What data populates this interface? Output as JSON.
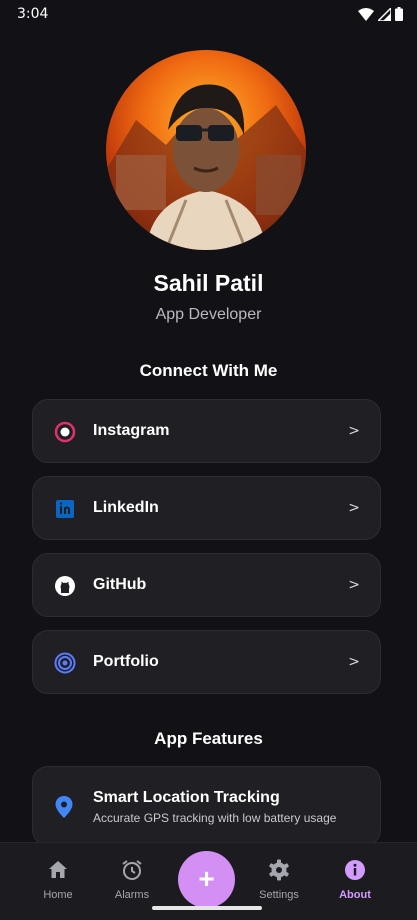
{
  "status_bar": {
    "time": "3:04"
  },
  "profile": {
    "name": "Sahil Patil",
    "role": "App Developer"
  },
  "connect": {
    "title": "Connect With Me",
    "items": [
      {
        "label": "Instagram",
        "icon": "instagram-icon",
        "arrow": ">"
      },
      {
        "label": "LinkedIn",
        "icon": "linkedin-icon",
        "arrow": ">"
      },
      {
        "label": "GitHub",
        "icon": "github-icon",
        "arrow": ">"
      },
      {
        "label": "Portfolio",
        "icon": "target-icon",
        "arrow": ">"
      }
    ]
  },
  "features": {
    "title": "App Features",
    "items": [
      {
        "title": "Smart Location Tracking",
        "description": "Accurate GPS tracking with low battery usage",
        "icon": "location-pin-icon"
      }
    ]
  },
  "bottom_nav": {
    "items": [
      {
        "label": "Home",
        "icon": "home-icon"
      },
      {
        "label": "Alarms",
        "icon": "alarm-clock-icon"
      },
      {
        "label": "Settings",
        "icon": "gear-icon"
      },
      {
        "label": "About",
        "icon": "info-icon",
        "active": true
      }
    ],
    "fab_label": "+"
  },
  "colors": {
    "background": "#121216",
    "card": "#1f1f24",
    "accent": "#d48ff5",
    "instagram": "#e1306c",
    "linkedin": "#0a66c2",
    "portfolio": "#5b7cff",
    "location": "#4285f4"
  }
}
